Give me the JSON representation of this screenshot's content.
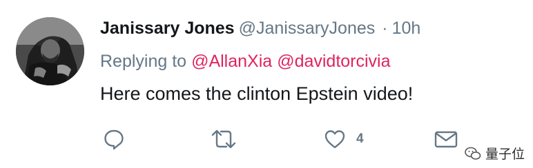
{
  "tweet": {
    "author": {
      "name": "Janissary Jones",
      "handle": "@JanissaryJones",
      "separator": "·",
      "time": "10h"
    },
    "replying": {
      "label": "Replying to",
      "mentions": [
        "@AllanXia",
        "@davidtorcivia"
      ]
    },
    "text": "Here comes the clinton Epstein video!",
    "actions": {
      "reply_icon": "reply-icon",
      "retweet_icon": "retweet-icon",
      "like_icon": "heart-icon",
      "like_count": "4",
      "message_icon": "envelope-icon"
    }
  },
  "watermark": {
    "text": "量子位"
  },
  "colors": {
    "text": "#14171a",
    "secondary": "#657786",
    "mention": "#e0245e",
    "icon": "#657786"
  }
}
